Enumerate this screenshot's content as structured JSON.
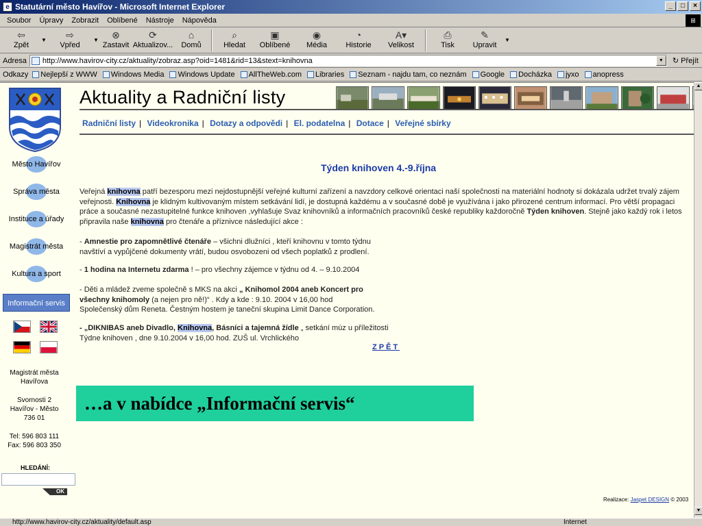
{
  "window": {
    "title": "Statutární město Havířov - Microsoft Internet Explorer",
    "minimize": "_",
    "maximize": "□",
    "close": "×"
  },
  "menubar": {
    "items": [
      "Soubor",
      "Úpravy",
      "Zobrazit",
      "Oblíbené",
      "Nástroje",
      "Nápověda"
    ]
  },
  "toolbar": {
    "back": "Zpět",
    "forward": "Vpřed",
    "stop": "Zastavit",
    "refresh": "Aktualizov...",
    "home": "Domů",
    "search": "Hledat",
    "favorites": "Oblíbené",
    "media": "Média",
    "history": "Historie",
    "size": "Velikost",
    "print": "Tisk",
    "edit": "Upravit"
  },
  "addressbar": {
    "label": "Adresa",
    "url": "http://www.havirov-city.cz/aktuality/zobraz.asp?oid=1481&rid=13&stext=knihovna",
    "go": "Přejít"
  },
  "linksbar": {
    "label": "Odkazy",
    "links": [
      "Nejlepší z WWW",
      "Windows Media",
      "Windows Update",
      "AllTheWeb.com",
      "Libraries",
      "Seznam - najdu tam, co neznám",
      "Google",
      "Docházka",
      "jyxo",
      "anopress"
    ]
  },
  "sidebar": {
    "nav": [
      "Město Havířov",
      "Správa města",
      "Instituce a úřady",
      "Magistrát města",
      "Kultura a sport",
      "Informační servis"
    ],
    "contact": {
      "org_line1": "Magistrát města",
      "org_line2": "Havířova",
      "addr_line1": "Svornosti 2",
      "addr_line2": "Havířov - Město",
      "addr_line3": "736 01",
      "tel": "Tel: 596 803 111",
      "fax": "Fax: 596 803 350"
    },
    "search_label": "HLEDÁNÍ:",
    "search_value": "",
    "ok": "OK"
  },
  "page": {
    "heading": "Aktuality a Radniční listy",
    "topnav": [
      "Radniční listy",
      "Videokronika",
      "Dotazy a odpovědi",
      "El. podatelna",
      "Dotace",
      "Veřejné sbírky"
    ],
    "nav_separator": "|",
    "article_title": "Týden knihoven 4.-9.října",
    "p1": {
      "t1": "Veřejná ",
      "h1": "knihovna",
      "t2": " patří bezesporu mezi nejdostupnější veřejné kulturní zařízení a navzdory celkové orientaci naší společnosti na materiální hodnoty si dokázala udržet trvalý zájem veřejnosti. ",
      "h2": "Knihovna",
      "t3": " je klidným kultivovaným místem setkávání lidí, je dostupná každému a v současné době je využívána i jako přirozené centrum informací. Pro větší propagaci práce a současné nezastupitelné funkce knihoven ,vyhlašuje Svaz knihovníků a informačních pracovníků české republiky každoročně ",
      "b1": "Týden knihoven",
      "t4": ". Stejně jako každý rok i letos připravila naše ",
      "h3": "knihovna",
      "t5": " pro čtenáře a příznivce následující akce :"
    },
    "p2": {
      "dash": "- ",
      "b": "Amnestie pro zapomnětlivé čtenáře",
      "t1": " – všichni dlužníci , kteří knihovnu v tomto týdnu",
      "t2": "navštíví a vypůjčené dokumenty vrátí, budou osvobozeni od všech poplatků z prodlení."
    },
    "p3": {
      "dash": "- ",
      "b": "1 hodina na Internetu zdarma",
      "t": " ! – pro všechny zájemce v týdnu od 4. – 9.10.2004"
    },
    "p4": {
      "t1": "- Děti a mládež zveme společně s MKS na akci ",
      "b1": "„ Knihomol 2004 aneb Koncert pro",
      "b2": "všechny knihomoly",
      "t2": " (a nejen pro ně!)“ . Kdy a kde : 9.10. 2004 v 16,00 hod",
      "t3": "Společenský dům Reneta. Čestným hostem je taneční skupina Limit Dance Corporation."
    },
    "p5": {
      "b1": "- „DIKNIBAS aneb Divadlo, ",
      "h1": "Knihovna",
      "b2": ", Básníci a tajemná žídle",
      "t1": " „ setkání múz u příležitosti",
      "t2": "Týdne knihoven , dne 9.10.2004 v 16,00 hod. ZUŠ ul. Vrchlického"
    },
    "back": "ZPĚT",
    "overlay": "…a v nabídce „Informační servis“",
    "credit_prefix": "Realizace: ",
    "credit_link": "Jaspet DESIGN",
    "credit_suffix": " © 2003"
  },
  "statusbar": {
    "url": "http://www.havirov-city.cz/aktuality/default.asp",
    "zone": "Internet"
  },
  "colors": {
    "link_blue": "#2a5db0",
    "title_blue": "#1a3aa8",
    "highlight": "#b8c8f0",
    "overlay_green": "#1fcf9c",
    "page_bg": "#fffff0"
  }
}
